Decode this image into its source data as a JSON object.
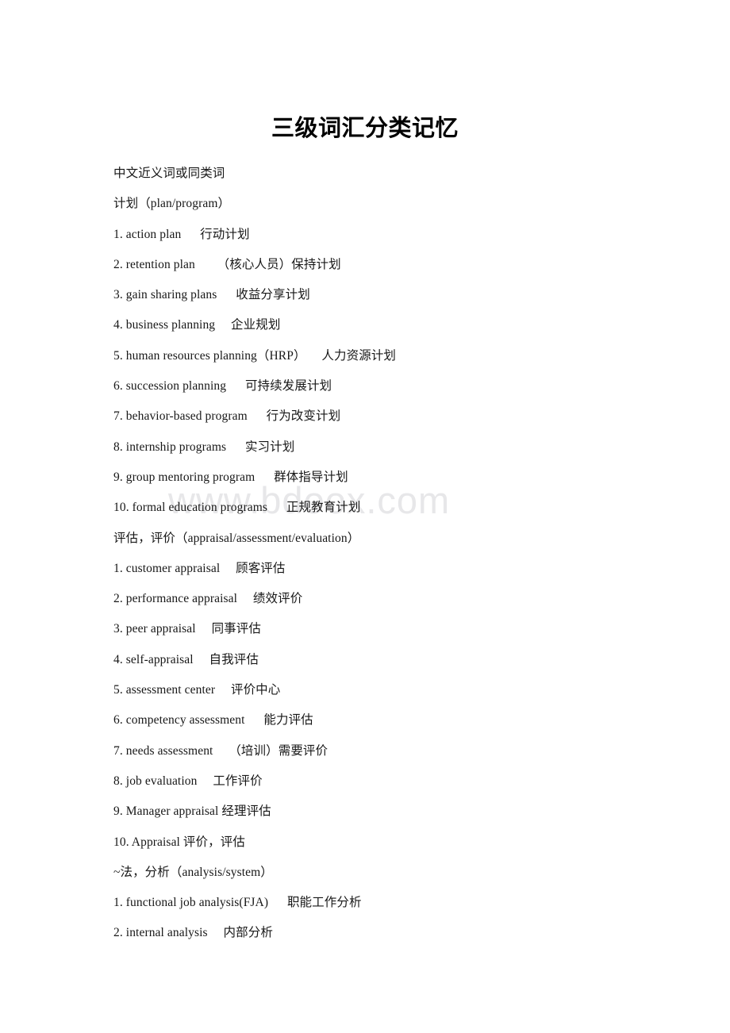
{
  "document": {
    "title": "三级词汇分类记忆",
    "watermark": "www.bdoox.com",
    "lines": [
      {
        "id": "intro-synonyms",
        "text": "中文近义词或同类词"
      },
      {
        "id": "section-plan",
        "text": "计划（plan/program）"
      },
      {
        "id": "plan-1",
        "text": "1. action plan      行动计划"
      },
      {
        "id": "plan-2",
        "text": "2. retention plan       （核心人员）保持计划"
      },
      {
        "id": "plan-3",
        "text": "3. gain sharing plans      收益分享计划"
      },
      {
        "id": "plan-4",
        "text": "4. business planning     企业规划"
      },
      {
        "id": "plan-5",
        "text": "5. human resources planning（HRP）     人力资源计划"
      },
      {
        "id": "plan-6",
        "text": "6. succession planning      可持续发展计划"
      },
      {
        "id": "plan-7",
        "text": "7. behavior-based program      行为改变计划"
      },
      {
        "id": "plan-8",
        "text": "8. internship programs      实习计划"
      },
      {
        "id": "plan-9",
        "text": "9. group mentoring program      群体指导计划"
      },
      {
        "id": "plan-10",
        "text": "10. formal education programs      正规教育计划"
      },
      {
        "id": "section-appraisal",
        "text": "评估，评价（appraisal/assessment/evaluation）"
      },
      {
        "id": "appraisal-1",
        "text": "1. customer appraisal     顾客评估"
      },
      {
        "id": "appraisal-2",
        "text": "2. performance appraisal     绩效评价"
      },
      {
        "id": "appraisal-3",
        "text": "3. peer appraisal     同事评估"
      },
      {
        "id": "appraisal-4",
        "text": "4. self-appraisal     自我评估"
      },
      {
        "id": "appraisal-5",
        "text": "5. assessment center     评价中心"
      },
      {
        "id": "appraisal-6",
        "text": "6. competency assessment      能力评估"
      },
      {
        "id": "appraisal-7",
        "text": "7. needs assessment     （培训）需要评价"
      },
      {
        "id": "appraisal-8",
        "text": "8. job evaluation     工作评价"
      },
      {
        "id": "appraisal-9",
        "text": "9. Manager appraisal 经理评估"
      },
      {
        "id": "appraisal-10",
        "text": "10. Appraisal 评价，评估"
      },
      {
        "id": "section-analysis",
        "text": "~法，分析（analysis/system）"
      },
      {
        "id": "analysis-1",
        "text": "1. functional job analysis(FJA)      职能工作分析"
      },
      {
        "id": "analysis-2",
        "text": "2. internal analysis     内部分析"
      }
    ]
  }
}
